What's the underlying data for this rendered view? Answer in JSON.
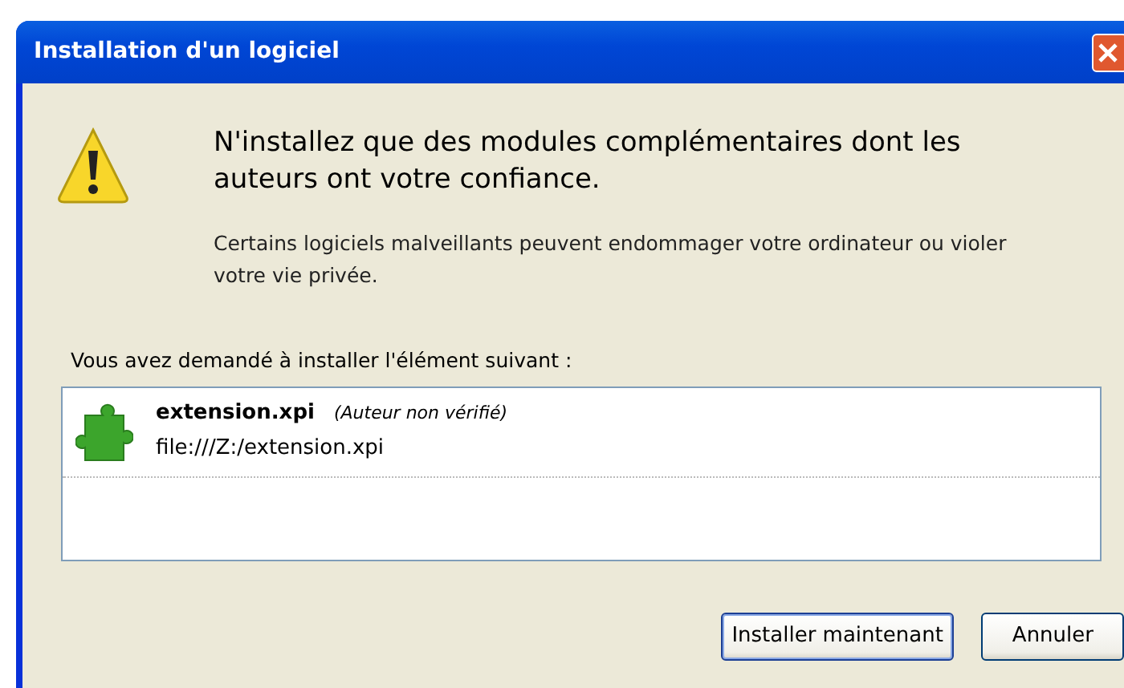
{
  "window": {
    "title": "Installation d'un logiciel"
  },
  "warning": {
    "heading": "N'installez que des modules complémentaires dont les auteurs ont votre confiance.",
    "text": "Certains logiciels malveillants peuvent endommager votre ordinateur ou violer votre vie privée."
  },
  "list_label": "Vous avez demandé à installer l'élément suivant :",
  "items": [
    {
      "name": "extension.xpi",
      "author": "(Auteur non vérifié)",
      "url": "file:///Z:/extension.xpi"
    }
  ],
  "buttons": [
    {
      "label": "Installer maintenant",
      "default": true
    },
    {
      "label": "Annuler",
      "default": false
    }
  ]
}
